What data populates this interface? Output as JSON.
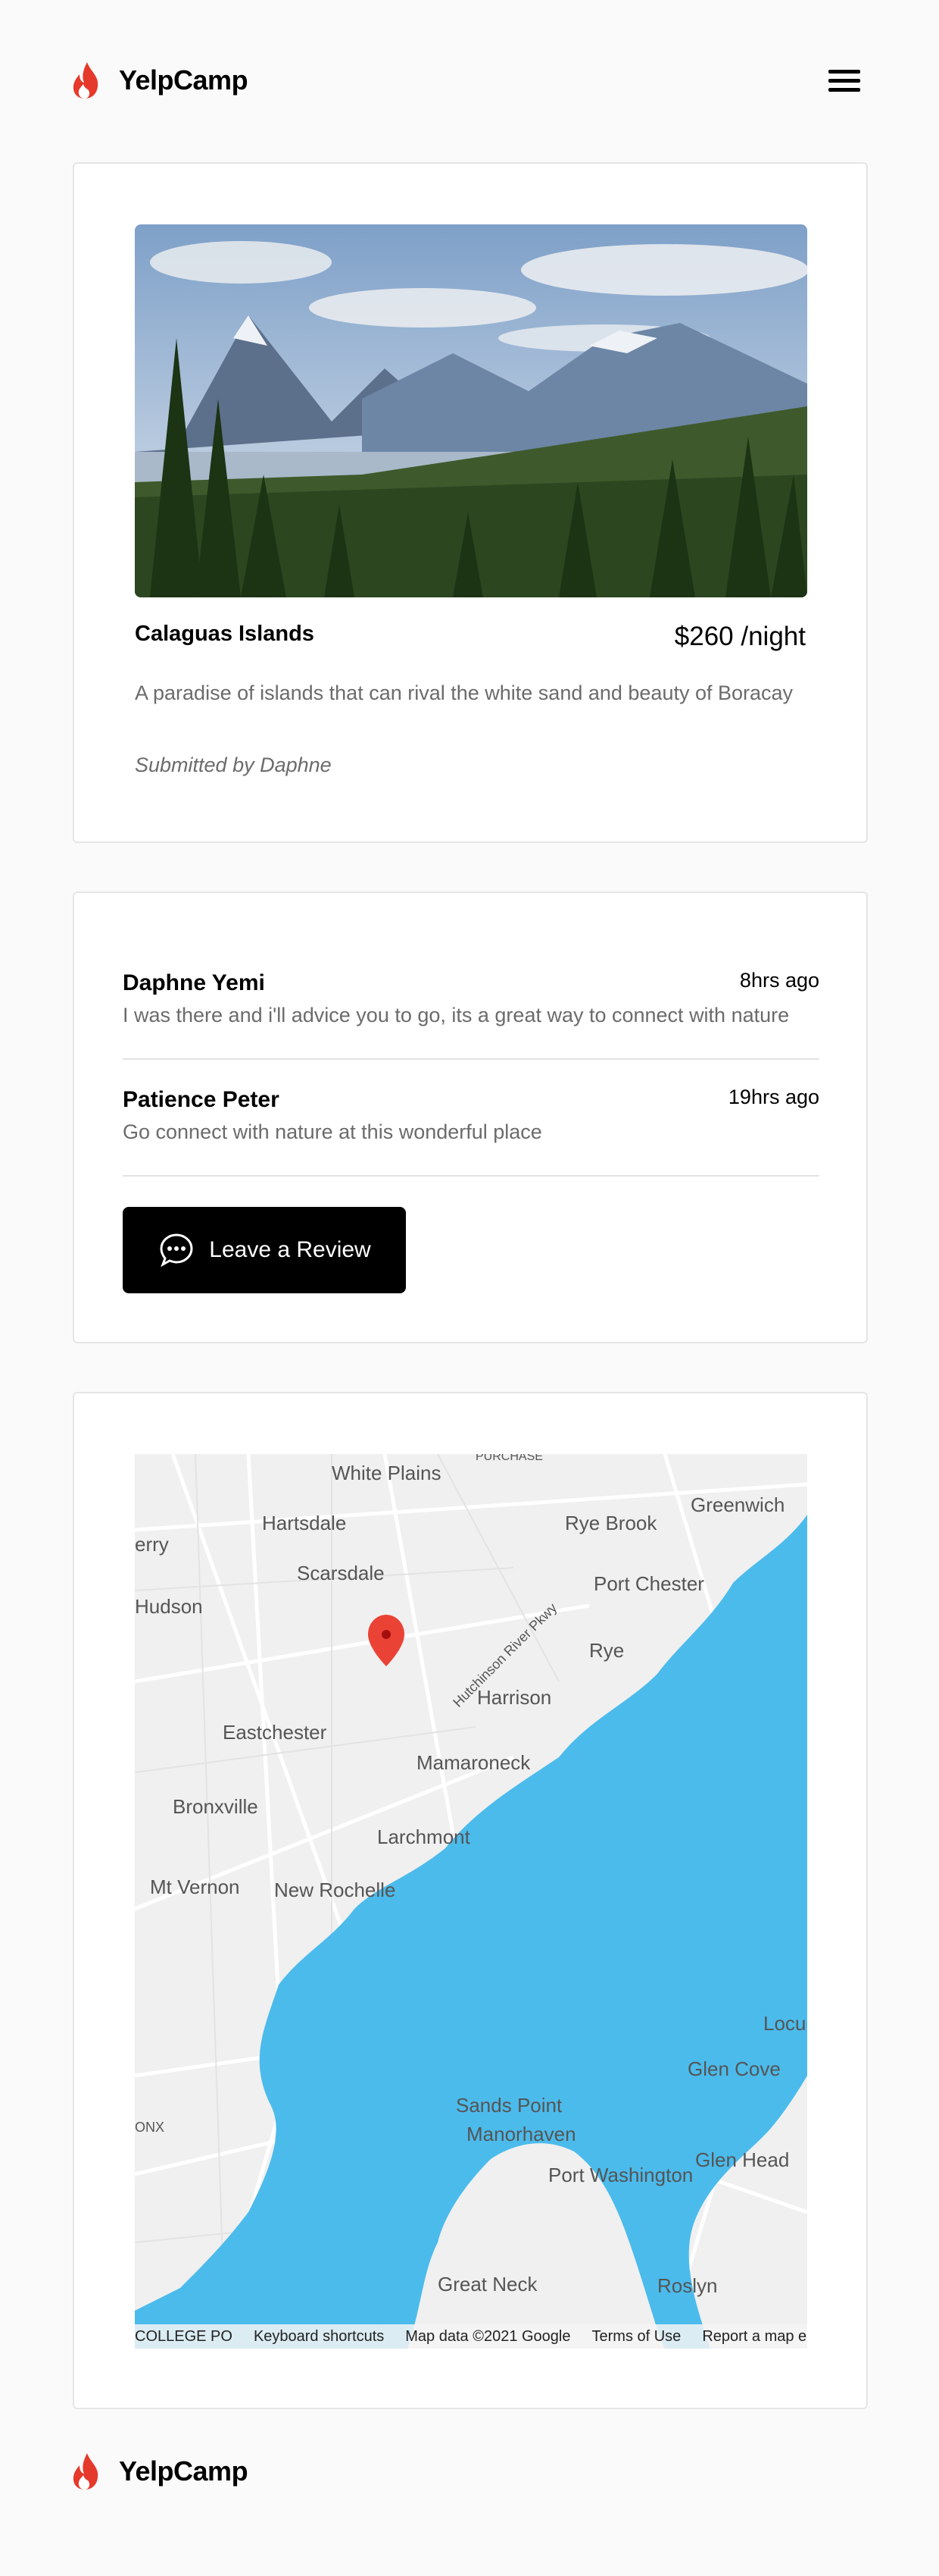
{
  "header": {
    "brand": "YelpCamp",
    "menu_icon": "hamburger-menu-icon"
  },
  "campground": {
    "title": "Calaguas Islands",
    "price": "$260 /night",
    "description": "A paradise of islands that can rival the white sand and beauty of Boracay",
    "author": "Submitted by Daphne"
  },
  "reviews": [
    {
      "name": "Daphne Yemi",
      "time": "8hrs ago",
      "text": "I was there and i'll advice you to go, its a great way to connect with nature"
    },
    {
      "name": "Patience Peter",
      "time": "19hrs ago",
      "text": "Go connect with nature at this wonderful place"
    }
  ],
  "review_button": {
    "label": "Leave a Review",
    "icon": "chat-bubble-icon"
  },
  "map": {
    "places": [
      "White Plains",
      "Hartsdale",
      "Scarsdale",
      "Rye Brook",
      "Greenwich",
      "Port Chester",
      "Rye",
      "Harrison",
      "Eastchester",
      "Mamaroneck",
      "Bronxville",
      "Larchmont",
      "Mt Vernon",
      "New Rochelle",
      "Glen Cove",
      "Sands Point",
      "Manorhaven",
      "Port Washington",
      "Glen Head",
      "Great Neck",
      "Roslyn",
      "Hudson",
      "Hutchinson River Pkwy",
      "PURCHASE",
      "Locu",
      "ONX",
      "erry"
    ],
    "footer": {
      "college": "COLLEGE PO",
      "shortcuts": "Keyboard shortcuts",
      "data": "Map data ©2021 Google",
      "terms": "Terms of Use",
      "report": "Report a map error"
    },
    "marker_icon": "map-pin-icon",
    "colors": {
      "water": "#4bbbec",
      "land": "#f0f0f0",
      "pin": "#ea4335"
    }
  },
  "footer": {
    "brand": "YelpCamp"
  },
  "colors": {
    "accent": "#e5392b",
    "button": "#000000"
  }
}
